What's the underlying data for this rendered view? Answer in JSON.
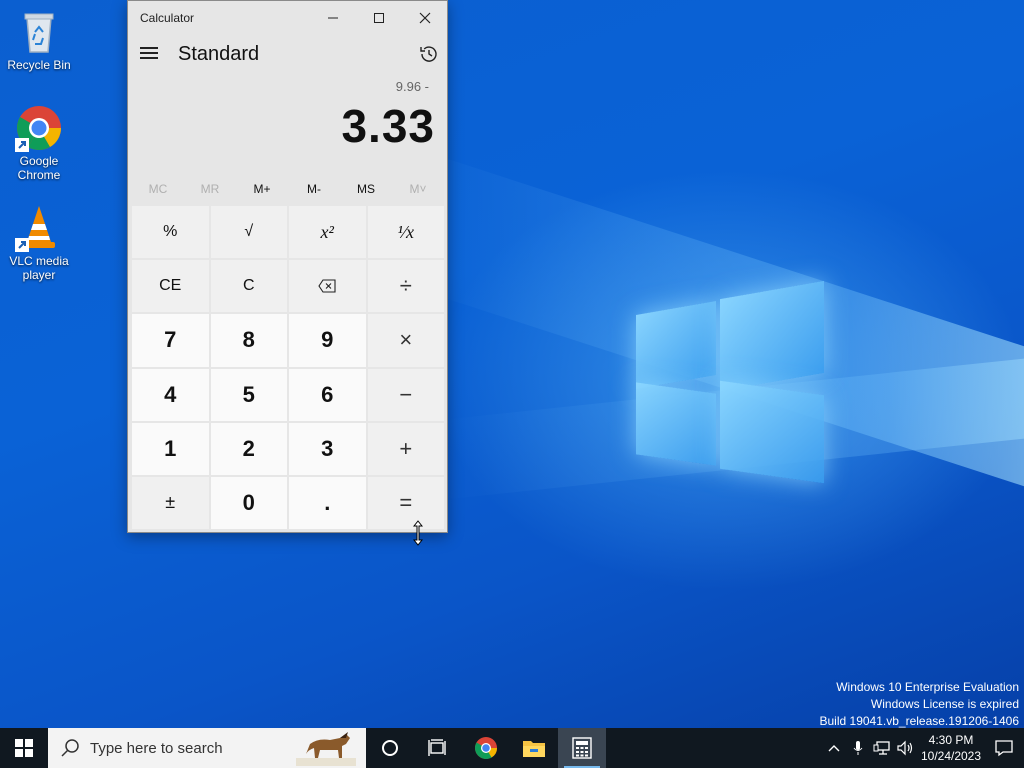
{
  "desktop": {
    "icons": [
      {
        "label": "Recycle Bin",
        "icon": "recycle-bin-icon"
      },
      {
        "label": "Google Chrome",
        "icon": "chrome-icon"
      },
      {
        "label": "VLC media player",
        "icon": "vlc-icon"
      }
    ],
    "watermark": {
      "line1": "Windows 10 Enterprise Evaluation",
      "line2": "Windows License is expired",
      "line3": "Build 19041.vb_release.191206-1406"
    }
  },
  "calculator": {
    "window_title": "Calculator",
    "mode": "Standard",
    "expression": "9.96 -",
    "display": "3.33",
    "memory": [
      {
        "label": "MC",
        "enabled": false
      },
      {
        "label": "MR",
        "enabled": false
      },
      {
        "label": "M+",
        "enabled": true
      },
      {
        "label": "M-",
        "enabled": true
      },
      {
        "label": "MS",
        "enabled": true
      },
      {
        "label": "M˅",
        "enabled": false
      }
    ],
    "keys": {
      "percent": "%",
      "sqrt": "√",
      "square": "x²",
      "reciprocal": "¹⁄x",
      "ce": "CE",
      "c": "C",
      "backspace": "⌫",
      "divide": "÷",
      "seven": "7",
      "eight": "8",
      "nine": "9",
      "multiply": "×",
      "four": "4",
      "five": "5",
      "six": "6",
      "minus": "−",
      "one": "1",
      "two": "2",
      "three": "3",
      "plus": "+",
      "negate": "±",
      "zero": "0",
      "decimal": ".",
      "equals": "="
    }
  },
  "taskbar": {
    "search_placeholder": "Type here to search",
    "time": "4:30 PM",
    "date": "10/24/2023"
  },
  "colors": {
    "desktop_blue": "#0a62d6",
    "taskbar": "#101820",
    "accent": "#76b9ed"
  }
}
